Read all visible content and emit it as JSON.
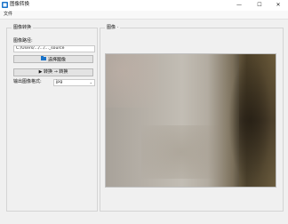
{
  "window": {
    "title": "图像转换",
    "minimize_glyph": "—",
    "maximize_glyph": "☐",
    "close_glyph": "✕"
  },
  "menu": {
    "file": "文件"
  },
  "settings": {
    "group_title": "图像转换",
    "path_label": "图像路径:",
    "path_value": "C:/Users/.../.../..._source",
    "browse_label": "选择图像",
    "convert_label": "▶ 转换 → 转换",
    "format_label": "输出图像格式:",
    "format_value": "jpg"
  },
  "preview": {
    "group_title": "图像 ·"
  },
  "colors": {
    "accent": "#1a73c9",
    "panel_bg": "#f0f0f0"
  },
  "icons": {
    "app": "app-icon",
    "browse": "folder-icon",
    "convert": "play-icon",
    "dropdown": "chevron-down-icon"
  }
}
